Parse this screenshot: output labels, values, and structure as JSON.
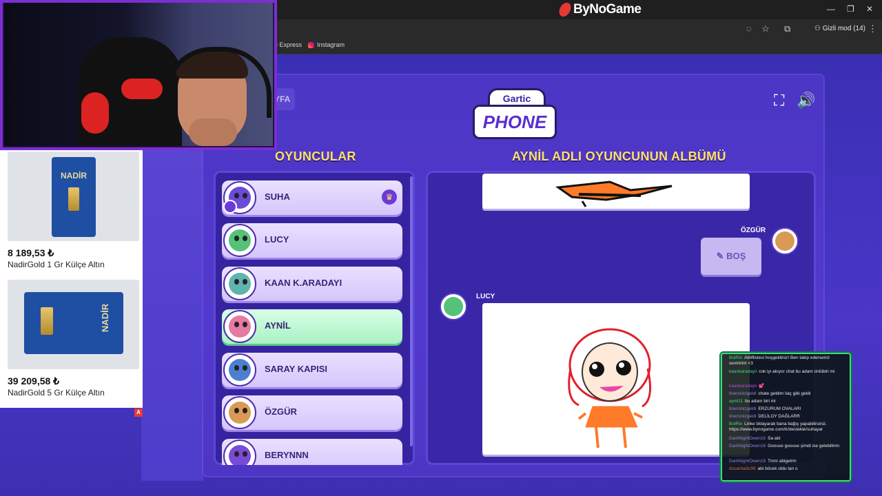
{
  "browser": {
    "brand": "ByNoGame",
    "incognito_label": "Gizli mod (14)",
    "bookmarks": [
      "e Express",
      "Instagram"
    ]
  },
  "game": {
    "logo_top": "Gartic",
    "logo_main": "PHONE",
    "partial_button": "YFA",
    "players_heading": "OYUNCULAR",
    "album_heading": "AYNİL ADLI OYUNCUNUN ALBÜMÜ",
    "players": [
      {
        "name": "SUHA",
        "color": "#6b4bd8",
        "host": true
      },
      {
        "name": "LUCY",
        "color": "#55c27a",
        "host": false
      },
      {
        "name": "KAAN K.ARADAYI",
        "color": "#5fb3b0",
        "host": false
      },
      {
        "name": "AYNİL",
        "color": "#e57aa3",
        "host": false,
        "active": true
      },
      {
        "name": "SARAY KAPISI",
        "color": "#4d7fd1",
        "host": false
      },
      {
        "name": "ÖZGÜR",
        "color": "#d89a55",
        "host": false
      },
      {
        "name": "BERYNNN",
        "color": "#7a4bd8",
        "host": false
      }
    ],
    "album": {
      "entry1_author": "ÖZGÜR",
      "entry1_text": "BOŞ",
      "entry2_author": "LUCY"
    }
  },
  "ads": [
    {
      "price": "8 189,53 ₺",
      "title": "NadirGold 1 Gr Külçe Altın",
      "brand_text": "NADİR"
    },
    {
      "price": "39 209,58 ₺",
      "title": "NadirGold 5 Gr Külçe Altın",
      "brand_text": "NADİR"
    }
  ],
  "ad_badge": "A",
  "chat": [
    {
      "user": "BotRix",
      "color": "#3ddc84",
      "text": "Aktiflistesi hoşgeldiniz! Ben takip ederseniz sevinirim <3"
    },
    {
      "user": "kaankaradayii",
      "color": "#3ddc84",
      "text": "cok iyi akıyor chat bu adam ünlübiri mi"
    },
    {
      "user": "kaankaradayii",
      "color": "#c04ad8",
      "text": "💕"
    },
    {
      "user": "tinercinizgeldi",
      "color": "#9a7fe0",
      "text": "chate geldim ilaç gibi geldi"
    },
    {
      "user": "aynil11",
      "color": "#3ddc84",
      "text": "bu adam biri mi"
    },
    {
      "user": "tinercinizgeldi",
      "color": "#9a7fe0",
      "text": "ERZURUM OVALARI"
    },
    {
      "user": "tinercinizgeldi",
      "color": "#9a7fe0",
      "text": "DELİLOY DAĞLARR"
    },
    {
      "user": "BotRix",
      "color": "#3ddc84",
      "text": "Linke tıklayarak bana bağış yapabilirsiniz. https://www.bynogame.com/tr/destekle/suhayar"
    },
    {
      "user": "DarkNightOwen16",
      "color": "#9a7fe0",
      "text": "Sa abi"
    },
    {
      "user": "DarkNightOwen16",
      "color": "#9a7fe0",
      "text": "Goouse goouse şimdi ise gelebilirim"
    },
    {
      "user": "DarkNightOwen16",
      "color": "#9a7fe0",
      "text": "Tmm abigelrm"
    },
    {
      "user": "dusantadic06",
      "color": "#d86a3d",
      "text": "abi böcek oldu lan o"
    }
  ]
}
